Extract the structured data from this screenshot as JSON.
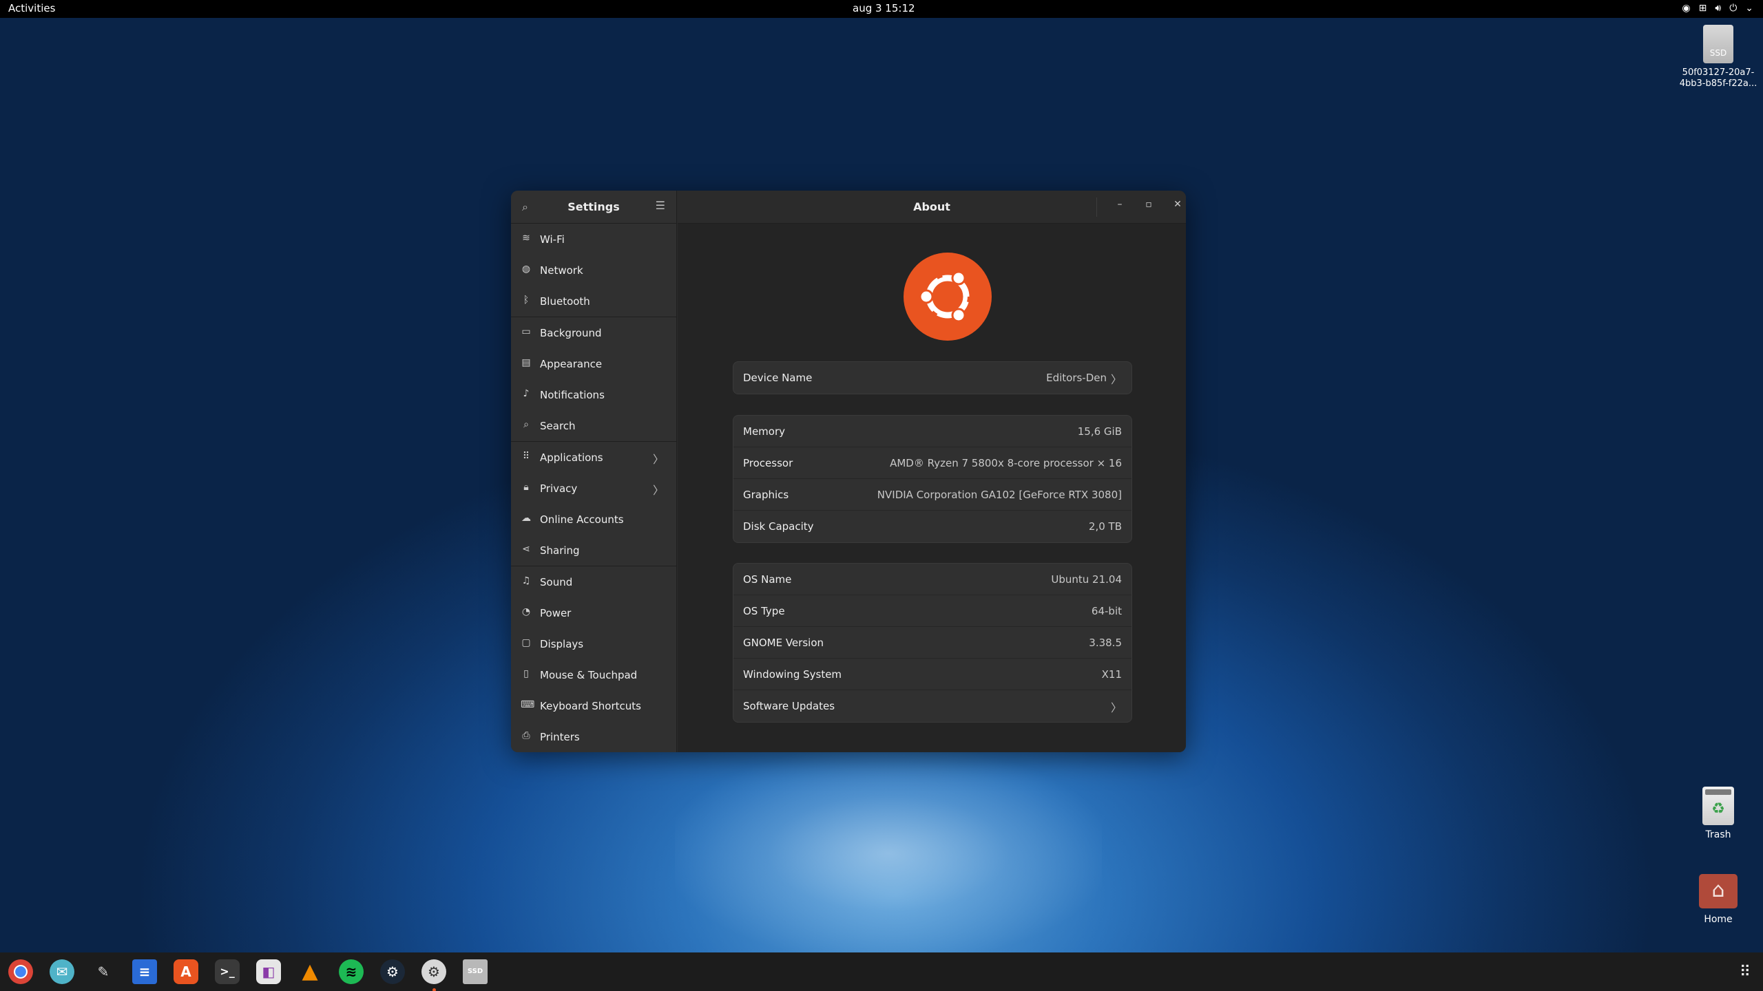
{
  "topbar": {
    "activities": "Activities",
    "clock": "aug 3  15:12",
    "tray_icons": [
      "steam-tray-icon",
      "network-icon",
      "volume-icon",
      "power-icon",
      "chevron-down-icon"
    ]
  },
  "desktop": {
    "drive_label": "50f03127-20a7-\n4bb3-b85f-f22a...",
    "drive_badge": "SSD",
    "trash_label": "Trash",
    "home_label": "Home"
  },
  "sidebar": {
    "title": "Settings",
    "items": [
      {
        "label": "Wi-Fi",
        "icon": "wifi-icon"
      },
      {
        "label": "Network",
        "icon": "network-globe-icon"
      },
      {
        "label": "Bluetooth",
        "icon": "bluetooth-icon"
      },
      {
        "label": "Background",
        "icon": "background-icon"
      },
      {
        "label": "Appearance",
        "icon": "appearance-icon"
      },
      {
        "label": "Notifications",
        "icon": "bell-icon"
      },
      {
        "label": "Search",
        "icon": "search-icon"
      },
      {
        "label": "Applications",
        "icon": "grid-icon"
      },
      {
        "label": "Privacy",
        "icon": "lock-icon"
      },
      {
        "label": "Online Accounts",
        "icon": "cloud-icon"
      },
      {
        "label": "Sharing",
        "icon": "share-icon"
      },
      {
        "label": "Sound",
        "icon": "music-note-icon"
      },
      {
        "label": "Power",
        "icon": "power-icon"
      },
      {
        "label": "Displays",
        "icon": "display-icon"
      },
      {
        "label": "Mouse & Touchpad",
        "icon": "mouse-icon"
      },
      {
        "label": "Keyboard Shortcuts",
        "icon": "keyboard-icon"
      },
      {
        "label": "Printers",
        "icon": "printer-icon"
      }
    ]
  },
  "main": {
    "title": "About",
    "device": {
      "label": "Device Name",
      "value": "Editors-Den"
    },
    "hardware": [
      {
        "label": "Memory",
        "value": "15,6 GiB"
      },
      {
        "label": "Processor",
        "value": "AMD® Ryzen 7 5800x 8-core processor × 16"
      },
      {
        "label": "Graphics",
        "value": "NVIDIA Corporation GA102 [GeForce RTX 3080]"
      },
      {
        "label": "Disk Capacity",
        "value": "2,0 TB"
      }
    ],
    "os": [
      {
        "label": "OS Name",
        "value": "Ubuntu 21.04"
      },
      {
        "label": "OS Type",
        "value": "64-bit"
      },
      {
        "label": "GNOME Version",
        "value": "3.38.5"
      },
      {
        "label": "Windowing System",
        "value": "X11"
      }
    ],
    "updates": {
      "label": "Software Updates"
    }
  },
  "colors": {
    "accent": "#e95420",
    "window": "#242424",
    "sidebar": "#303030",
    "card": "#303030"
  },
  "dock": {
    "apps": [
      "chrome-icon",
      "mail-icon",
      "editor-icon",
      "writer-icon",
      "app-store-icon",
      "terminal-icon",
      "app-icon",
      "vlc-icon",
      "spotify-icon",
      "steam-icon",
      "settings-icon",
      "drive-icon"
    ],
    "running": "settings-icon"
  }
}
